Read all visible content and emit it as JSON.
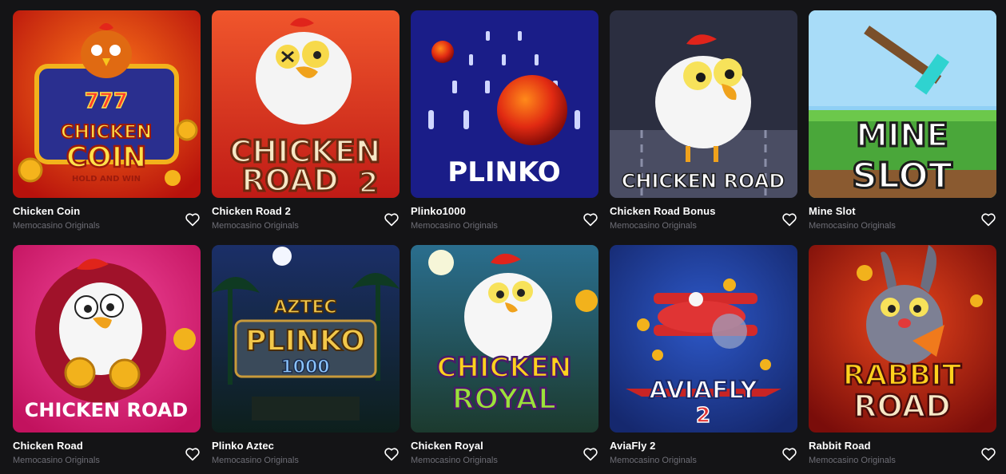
{
  "games": [
    {
      "title": "Chicken Coin",
      "provider": "Memocasino Originals",
      "art": [
        "777",
        "CHICKEN",
        "COIN",
        "HOLD AND WIN"
      ],
      "accent": "#e8331c"
    },
    {
      "title": "Chicken Road 2",
      "provider": "Memocasino Originals",
      "art": [
        "CHICKEN",
        "ROAD",
        "2"
      ],
      "accent": "#e8442a"
    },
    {
      "title": "Plinko1000",
      "provider": "Memocasino Originals",
      "art": [
        "PLINKO"
      ],
      "accent": "#1b1f8c"
    },
    {
      "title": "Chicken Road Bonus",
      "provider": "Memocasino Originals",
      "art": [
        "CHICKEN ROAD"
      ],
      "accent": "#3a3d52"
    },
    {
      "title": "Mine Slot",
      "provider": "Memocasino Originals",
      "art": [
        "MINE",
        "SLOT"
      ],
      "accent": "#4fae3a"
    },
    {
      "title": "Chicken Road",
      "provider": "Memocasino Originals",
      "art": [
        "CHICKEN ROAD"
      ],
      "accent": "#d52a78"
    },
    {
      "title": "Plinko Aztec",
      "provider": "Memocasino Originals",
      "art": [
        "AZTEC",
        "PLINKO",
        "1000"
      ],
      "accent": "#16313a"
    },
    {
      "title": "Chicken Royal",
      "provider": "Memocasino Originals",
      "art": [
        "CHICKEN",
        "ROYAL"
      ],
      "accent": "#2f6b8a"
    },
    {
      "title": "AviaFly 2",
      "provider": "Memocasino Originals",
      "art": [
        "AVIAFLY",
        "2"
      ],
      "accent": "#1e3b8c"
    },
    {
      "title": "Rabbit Road",
      "provider": "Memocasino Originals",
      "art": [
        "RABBIT",
        "ROAD"
      ],
      "accent": "#a81f14"
    }
  ],
  "icons": {
    "favorite": "heart-outline-icon"
  }
}
